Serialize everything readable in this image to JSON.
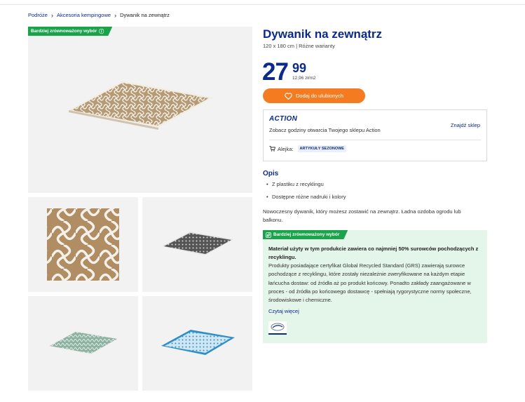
{
  "breadcrumb": {
    "items": [
      "Podróże",
      "Akcesoria kempingowe",
      "Dywanik na zewnątrz"
    ]
  },
  "gallery": {
    "badge_label": "Bardziej zrównoważony wybór"
  },
  "product": {
    "title": "Dywanik na zewnątrz",
    "subtitle": "120 x 180 cm | Różne warianty",
    "price_integer": "27",
    "price_decimal": "99",
    "unit_price": "12,96 zł/m2",
    "favorite_button": "Dodaj do ulubionych"
  },
  "store": {
    "logo_text": "ACTION",
    "opening_hours_text": "Zobacz godziny otwarcia Twojego sklepu Action",
    "find_store_link": "Znajdź sklep",
    "aisle_label": "Alejka:",
    "aisle_tag": "ARTYKUŁY SEZONOWE"
  },
  "description": {
    "title": "Opis",
    "bullets": [
      "Z plastiku z recyklingu",
      "Dostępne różne nadruki i kolory"
    ],
    "text": "Nowoczesny dywanik, który możesz zostawić na zewnątrz. Ładna ozdoba ogrodu lub balkonu."
  },
  "sustainability": {
    "badge_label": "Bardziej zrównoważony wybór",
    "heading": "Materiał użyty w tym produkcie zawiera co najmniej 50% surowców pochodzących z recyklingu.",
    "body": "Produkty posiadające certyfikat Global Recycled Standard (GRS) zawierają surowce pochodzące z recyklingu, które zostały niezależnie zweryfikowane na każdym etapie łańcucha dostaw: od źródła aż po produkt końcowy. Ponadto zakłady zaangażowane w proces - od źródła po końcowego dostawcę - spełniają rygorystyczne normy społeczne, środowiskowe i chemiczne.",
    "read_more": "Czytaj więcej"
  },
  "colors": {
    "brand_blue": "#0b2a8a",
    "accent_orange": "#f47b20",
    "sustainable_green": "#19a34a",
    "sustainable_bg": "#e4f5e9"
  },
  "icons": {
    "breadcrumb_separator": "chevron-right-icon",
    "badge_info": "info-icon",
    "favorite": "heart-icon",
    "aisle": "cart-icon",
    "sustainability": "leaf-icon"
  }
}
